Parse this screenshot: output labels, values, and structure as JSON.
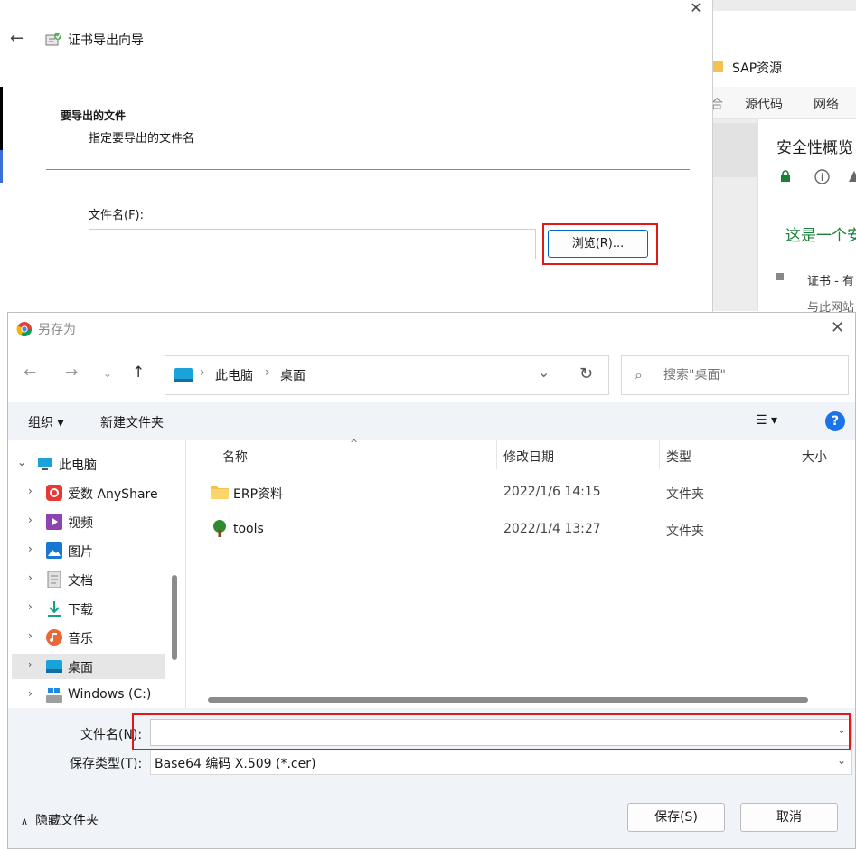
{
  "browser_bg": {
    "folder_label": "SAP资源",
    "tabs": [
      "合",
      "源代码",
      "网络"
    ],
    "security_title": "安全性概览",
    "secure_text": "这是一个安",
    "cert_item": "证书 - 有",
    "cert_item2": "与此网站"
  },
  "wizard": {
    "title": "证书导出向导",
    "close_glyph": "✕",
    "back_glyph": "←",
    "heading": "要导出的文件",
    "subheading": "指定要导出的文件名",
    "filename_label": "文件名(F):",
    "filename_value": "",
    "browse_label": "浏览(R)..."
  },
  "saveas": {
    "title": "另存为",
    "close_glyph": "✕",
    "breadcrumb": [
      "此电脑",
      "桌面"
    ],
    "search_placeholder": "搜索\"桌面\"",
    "toolbar": {
      "organize": "组织 ▾",
      "new_folder": "新建文件夹",
      "view": "☰  ▾",
      "help": "?"
    },
    "tree": [
      {
        "label": "此电脑",
        "icon": "pc-icon",
        "root": true,
        "expanded": true
      },
      {
        "label": "爱数 AnyShare",
        "icon": "anyshare-icon"
      },
      {
        "label": "视频",
        "icon": "video-icon"
      },
      {
        "label": "图片",
        "icon": "picture-icon"
      },
      {
        "label": "文档",
        "icon": "document-icon"
      },
      {
        "label": "下载",
        "icon": "download-icon"
      },
      {
        "label": "音乐",
        "icon": "music-icon"
      },
      {
        "label": "桌面",
        "icon": "desktop-icon",
        "selected": true
      },
      {
        "label": "Windows (C:)",
        "icon": "drive-icon"
      }
    ],
    "columns": {
      "name": "名称",
      "modified": "修改日期",
      "type": "类型",
      "size": "大小"
    },
    "files": [
      {
        "name": "ERP资料",
        "modified": "2022/1/6 14:15",
        "type": "文件夹",
        "icon": "folder-icon"
      },
      {
        "name": "tools",
        "modified": "2022/1/4 13:27",
        "type": "文件夹",
        "icon": "tree-folder-icon"
      }
    ],
    "filename_label": "文件名(N):",
    "filename_value": "",
    "filetype_label": "保存类型(T):",
    "filetype_value": "Base64 编码 X.509 (*.cer)",
    "hide_folders": "隐藏文件夹",
    "save_label": "保存(S)",
    "cancel_label": "取消"
  },
  "colors": {
    "accent": "#0067c0",
    "highlight": "#e01818",
    "help_blue": "#1a73e8",
    "secure_green": "#188038"
  }
}
